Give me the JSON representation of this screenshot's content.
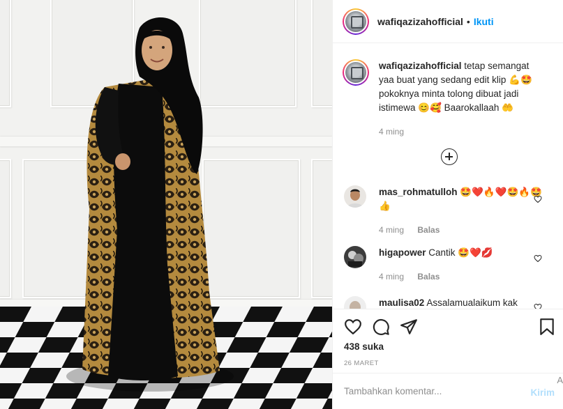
{
  "post": {
    "username": "wafiqazizahofficial",
    "follow_label": "Ikuti",
    "separator": "•",
    "caption": {
      "username": "wafiqazizahofficial",
      "text": "tetap semangat yaa buat yang sedang edit klip 💪🤩 pokoknya minta tolong dibuat jadi istimewa 😊🥰 Baarokallaah 🤲",
      "time": "4 ming"
    },
    "comments": [
      {
        "username": "mas_rohmatulloh",
        "text": "🤩❤️🔥❤️🤩🔥🤩👍",
        "time": "4 ming",
        "reply_label": "Balas"
      },
      {
        "username": "higapower",
        "text": "Cantik 🤩❤️💋",
        "time": "4 ming",
        "reply_label": "Balas"
      },
      {
        "username": "maulisa02",
        "text": "Assalamualaikum kak"
      }
    ],
    "likes": "438 suka",
    "date": "26 MARET",
    "add_comment_placeholder": "Tambahkan komentar...",
    "send_label": "Kirim",
    "corner_char": "A"
  },
  "icons": {
    "like": "heart-icon",
    "comment": "comment-icon",
    "share": "share-icon",
    "save": "bookmark-icon",
    "load_more": "plus-circle-icon",
    "comment_like": "heart-icon"
  },
  "colors": {
    "accent": "#0095f6",
    "muted": "#8e8e8e",
    "send_disabled": "#b2dffc",
    "text": "#262626"
  }
}
